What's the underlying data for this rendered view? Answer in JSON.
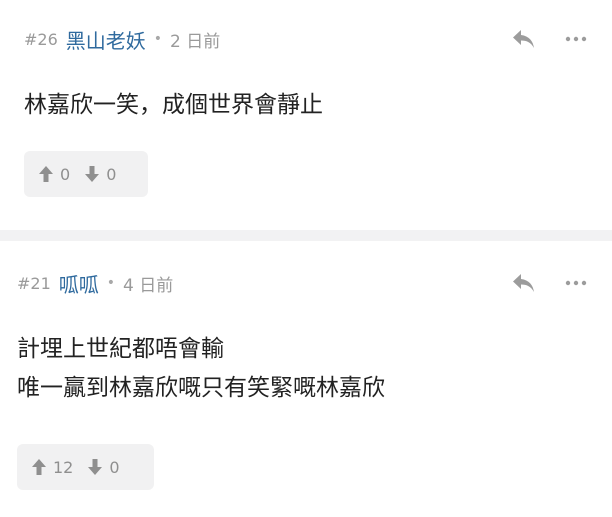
{
  "comments": [
    {
      "floor": "#26",
      "author": "黑山老妖",
      "separator": "•",
      "time": "2 日前",
      "lines": [
        "林嘉欣一笑，成個世界會靜止"
      ],
      "upvotes": "0",
      "downvotes": "0"
    },
    {
      "floor": "#21",
      "author": "呱呱",
      "separator": "•",
      "time": "4 日前",
      "lines": [
        "計埋上世紀都唔會輸",
        "唯一贏到林嘉欣嘅只有笑緊嘅林嘉欣"
      ],
      "upvotes": "12",
      "downvotes": "0"
    }
  ],
  "colors": {
    "author": "#2f6a9e",
    "meta": "#9a9a9a",
    "vote_bg": "#f1f1f2",
    "divider": "#f2f2f3"
  },
  "icons": [
    "reply-icon",
    "more-icon",
    "upvote-arrow-icon",
    "downvote-arrow-icon"
  ]
}
